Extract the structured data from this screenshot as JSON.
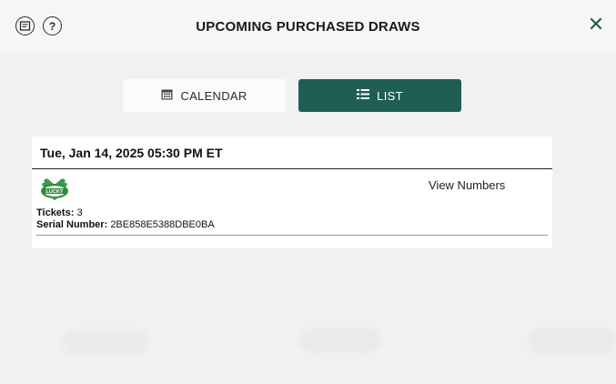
{
  "header": {
    "title": "UPCOMING PURCHASED DRAWS",
    "help_label": "?",
    "close_label": "✕"
  },
  "toggle": {
    "calendar_label": "CALENDAR",
    "list_label": "LIST",
    "active": "list"
  },
  "draw": {
    "datetime": "Tue, Jan 14, 2025 05:30 PM ET",
    "view_numbers_label": "View Numbers",
    "tickets_label": "Tickets:",
    "tickets_value": "3",
    "serial_label": "Serial Number:",
    "serial_value": "2BE858E5388DBE0BA",
    "logo_text": "LUCKY"
  },
  "colors": {
    "accent": "#1e5e55",
    "logo_green": "#2e8b3e"
  }
}
